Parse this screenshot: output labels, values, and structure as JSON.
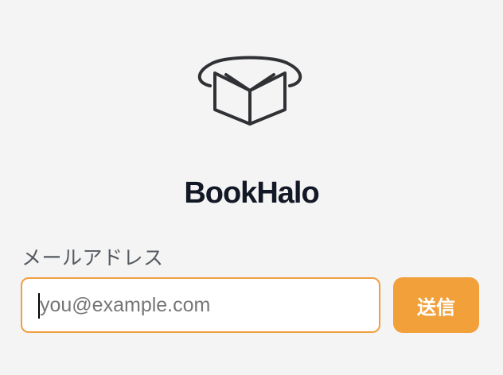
{
  "app": {
    "brand_name": "BookHalo",
    "logo_icon": "book-halo-icon"
  },
  "form": {
    "email_label": "メールアドレス",
    "email_placeholder": "you@example.com",
    "email_value": "",
    "submit_label": "送信"
  },
  "colors": {
    "background": "#f4f4f4",
    "accent": "#f1a03a",
    "brand_text": "#121826",
    "logo_stroke": "#2f3134"
  }
}
